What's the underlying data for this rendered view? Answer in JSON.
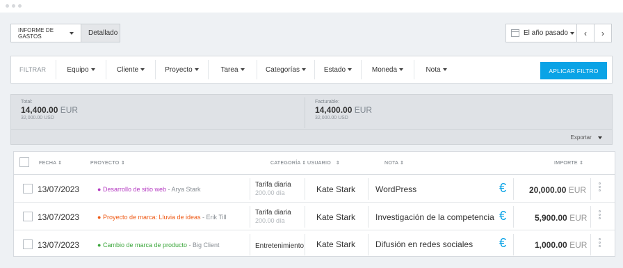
{
  "toolbar": {
    "report_type_label": "INFORME DE GASTOS",
    "view_label": "Detallado",
    "date_range_label": "El año pasado",
    "prev_symbol": "‹",
    "next_symbol": "›"
  },
  "filters": {
    "label": "FILTRAR",
    "items": [
      "Equipo",
      "Cliente",
      "Proyecto",
      "Tarea",
      "Categorías",
      "Estado",
      "Moneda",
      "Nota"
    ],
    "apply_label": "APLICAR FILTRO"
  },
  "summary": {
    "total_label": "Total:",
    "total_amount": "14,400.00",
    "total_currency": "EUR",
    "total_usd": "32,000.00 USD",
    "billable_label": "Facturable:",
    "billable_amount": "14,400.00",
    "billable_currency": "EUR",
    "billable_usd": "32,000.00 USD",
    "export_label": "Exportar"
  },
  "table": {
    "headers": {
      "date": "FECHA",
      "project": "PROYECTO",
      "category": "CATEGORÍA",
      "user": "USUARIO",
      "note": "NOTA",
      "amount": "IMPORTE"
    },
    "sort_symbol": "⇕",
    "rows": [
      {
        "date": "13/07/2023",
        "project": "Desarrollo de sitio web",
        "client": "- Arya Stark",
        "project_color": "#b53cc2",
        "category": "Tarifa diaria",
        "category_sub": "200.00 día",
        "user": "Kate Stark",
        "note": "WordPress",
        "currency_symbol": "€",
        "amount": "20,000.00",
        "amount_currency": "EUR"
      },
      {
        "date": "13/07/2023",
        "project": "Proyecto de marca: Lluvia de ideas",
        "client": "- Erik Till",
        "project_color": "#ee5a16",
        "category": "Tarifa diaria",
        "category_sub": "200.00 día",
        "user": "Kate Stark",
        "note": "Investigación de la competencia",
        "currency_symbol": "€",
        "amount": "5,900.00",
        "amount_currency": "EUR"
      },
      {
        "date": "13/07/2023",
        "project": "Cambio de marca de producto",
        "client": "- Big Client",
        "project_color": "#3aa63a",
        "category": "Entretenimiento",
        "category_sub": "",
        "user": "Kate Stark",
        "note": "Difusión en redes sociales",
        "currency_symbol": "€",
        "amount": "1,000.00",
        "amount_currency": "EUR"
      }
    ]
  }
}
